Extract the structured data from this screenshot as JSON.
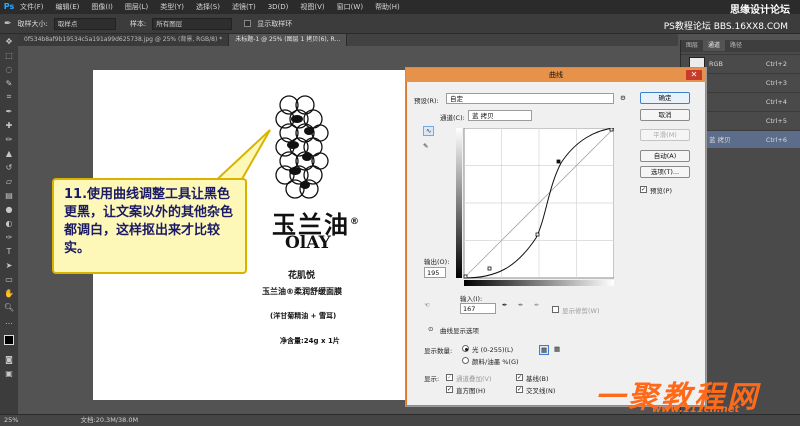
{
  "app": {
    "logo": "Ps",
    "menus": [
      "文件(F)",
      "编辑(E)",
      "图像(I)",
      "图层(L)",
      "类型(Y)",
      "选择(S)",
      "滤镜(T)",
      "3D(D)",
      "视图(V)",
      "窗口(W)",
      "帮助(H)"
    ]
  },
  "brand": {
    "top_right": "思缘设计论坛",
    "top_right_url": "PS教程论坛 BBS.16XX8.COM"
  },
  "options": {
    "sample_size_label": "取样大小:",
    "sample_size_value": "取样点",
    "sample_label": "样本:",
    "sample_value": "所有图层",
    "ring_label": "显示取样环"
  },
  "tabs": [
    {
      "label": "0f534b8af9b19534c5a191a99d625738.jpg @ 25% (背景, RGB/8) *",
      "active": false
    },
    {
      "label": "未标题-1 @ 25% (图层 1 拷贝(6), R...",
      "active": true
    }
  ],
  "canvas": {
    "brand_cn": "玉兰油",
    "reg_mark": "®",
    "brand_en": "OlAY",
    "line1": "花肌悦",
    "line2": "玉兰油®柔润舒缓面膜",
    "line3": "(洋甘菊精油 + 雪耳)",
    "line4": "净含量:24g x 1片"
  },
  "callout": {
    "text": "11.使用曲线调整工具让黑色更黑，让文案以外的其他杂色都调白，这样抠出来才比较实。"
  },
  "status": {
    "zoom": "25%",
    "doc": "文档:20.3M/38.0M"
  },
  "panel": {
    "tabs": [
      "图层",
      "通道",
      "路径"
    ],
    "channels": [
      {
        "name": "RGB",
        "shortcut": "Ctrl+2",
        "selected": false
      },
      {
        "name": "",
        "shortcut": "Ctrl+3",
        "selected": false
      },
      {
        "name": "",
        "shortcut": "Ctrl+4",
        "selected": false
      },
      {
        "name": "",
        "shortcut": "Ctrl+5",
        "selected": false
      },
      {
        "name": "蓝 拷贝",
        "shortcut": "Ctrl+6",
        "selected": true
      }
    ]
  },
  "dialog": {
    "title": "曲线",
    "preset_label": "预设(R):",
    "preset_value": "自定",
    "channel_label": "通道(C):",
    "channel_value": "蓝 拷贝",
    "output_label": "输出(O):",
    "output_value": "195",
    "input_label": "输入(I):",
    "input_value": "167",
    "show_clipping": "显示修剪(W)",
    "options_toggle": "曲线显示选项",
    "show_amount_label": "显示数量:",
    "light_option": "光 (0-255)(L)",
    "pigment_option": "颜料/油墨 %(G)",
    "display_label": "显示:",
    "channel_overlay": "通道叠加(V)",
    "baseline": "基线(B)",
    "histogram": "直方图(H)",
    "intersection": "交叉线(N)",
    "buttons": {
      "ok": "确定",
      "cancel": "取消",
      "smooth": "平滑(M)",
      "auto": "自动(A)",
      "options": "选项(T)...",
      "preview": "预览(P)"
    }
  },
  "watermark": {
    "text": "一聚教程网",
    "url": "www.111cn.net"
  }
}
